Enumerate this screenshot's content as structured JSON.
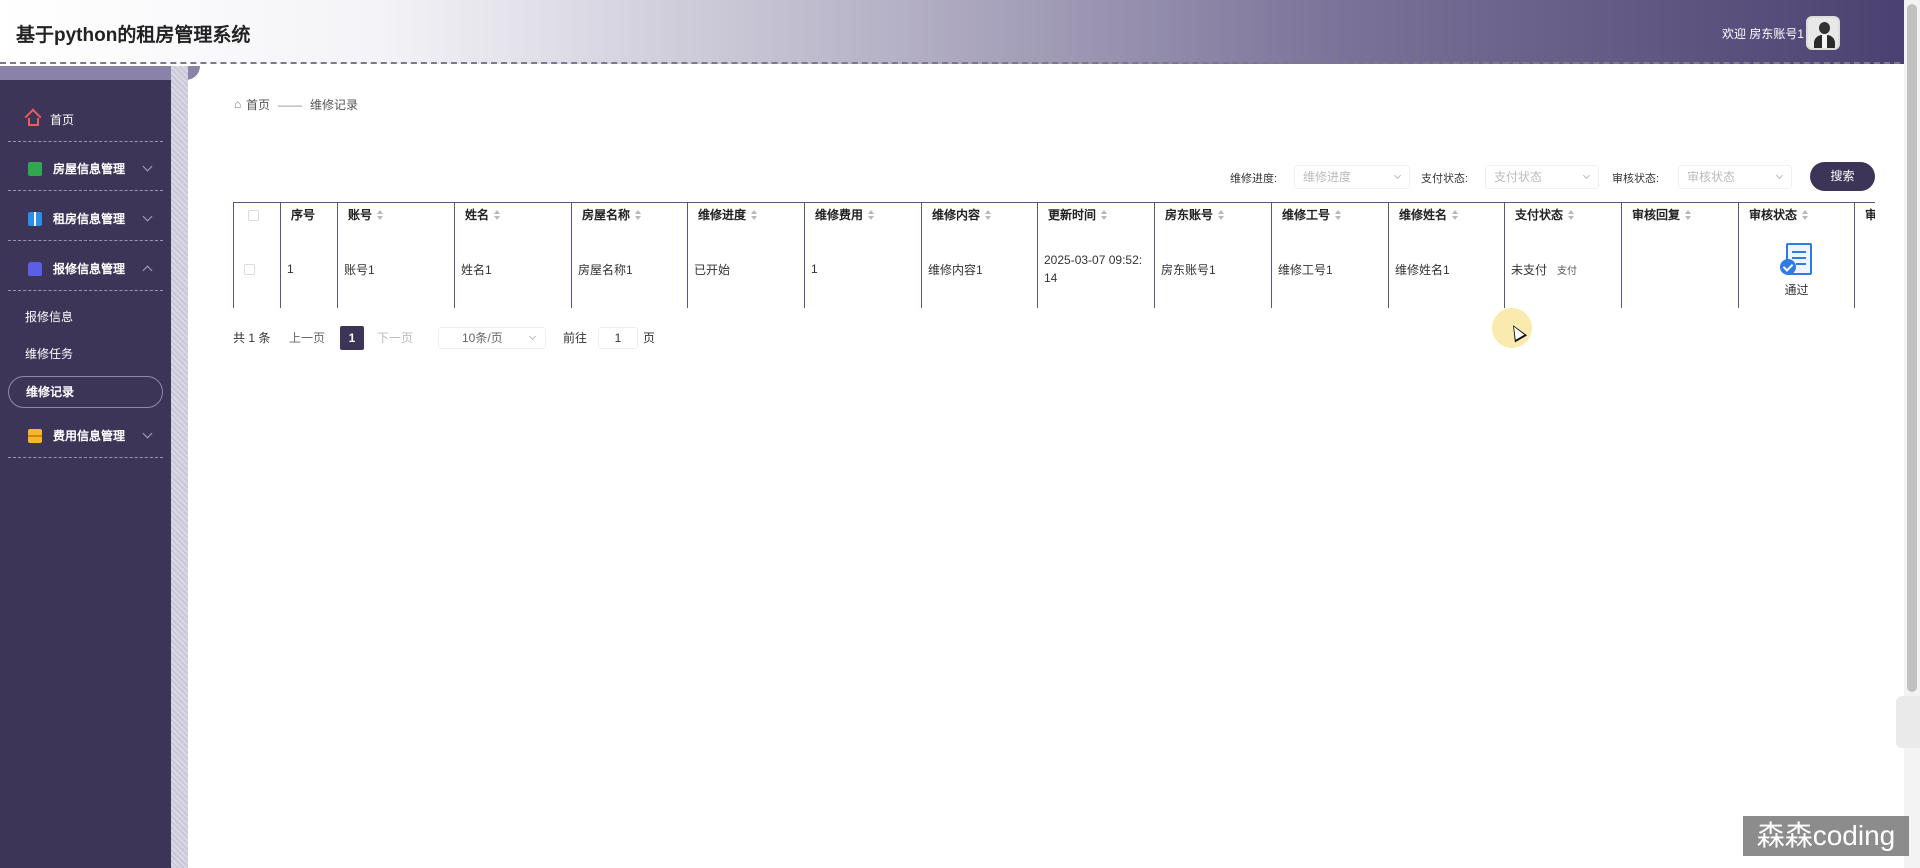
{
  "header": {
    "title": "基于python的租房管理系统",
    "welcome": "欢迎 房东账号1"
  },
  "sidebar": {
    "items": [
      {
        "label": "首页",
        "icon": "home-icon"
      },
      {
        "label": "房屋信息管理",
        "icon": "house-icon"
      },
      {
        "label": "租房信息管理",
        "icon": "book-icon"
      },
      {
        "label": "报修信息管理",
        "icon": "repair-icon"
      },
      {
        "label": "费用信息管理",
        "icon": "fee-icon"
      }
    ],
    "sub_items": [
      "报修信息",
      "维修任务",
      "维修记录"
    ],
    "active_sub": "维修记录"
  },
  "breadcrumb": {
    "home": "首页",
    "separator": "——",
    "current": "维修记录"
  },
  "search": {
    "repair_progress_label": "维修进度:",
    "repair_progress_placeholder": "维修进度",
    "pay_status_label": "支付状态:",
    "pay_status_placeholder": "支付状态",
    "audit_status_label": "审核状态:",
    "audit_status_placeholder": "审核状态",
    "search_button": "搜索"
  },
  "table": {
    "headers": [
      "序号",
      "账号",
      "姓名",
      "房屋名称",
      "维修进度",
      "维修费用",
      "维修内容",
      "更新时间",
      "房东账号",
      "维修工号",
      "维修姓名",
      "支付状态",
      "审核回复",
      "审核状态",
      "审"
    ],
    "rows": [
      {
        "index": "1",
        "account": "账号1",
        "name": "姓名1",
        "house_name": "房屋名称1",
        "repair_progress": "已开始",
        "repair_fee": "1",
        "repair_content": "维修内容1",
        "update_time": "2025-03-07 09:52:14",
        "landlord_account": "房东账号1",
        "repair_worker_id": "维修工号1",
        "repair_worker_name": "维修姓名1",
        "pay_status": "未支付",
        "pay_action": "支付",
        "audit_reply": "",
        "audit_status": "通过"
      }
    ]
  },
  "pagination": {
    "total": "共 1 条",
    "prev": "上一页",
    "current_page": "1",
    "next": "下一页",
    "page_size": "10条/页",
    "goto_label": "前往",
    "goto_value": "1",
    "page_suffix": "页"
  },
  "watermark": "森森coding",
  "colors": {
    "primary": "#3d3558",
    "sidebar_bg": "#3d3558",
    "home_icon": "#f05a5a",
    "house_icon": "#2fa84f",
    "book_icon": "#2d8ee8",
    "repair_icon": "#5b5ee8",
    "fee_icon": "#f5b82a"
  }
}
